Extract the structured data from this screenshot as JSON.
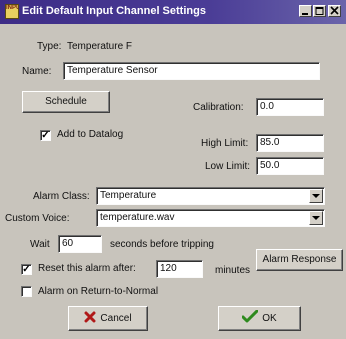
{
  "window": {
    "title": "Edit Default Input Channel Settings",
    "icon_text": "INPUT",
    "controls": [
      "minimize-icon",
      "maximize-icon",
      "close-icon"
    ]
  },
  "type": {
    "label": "Type:",
    "value": "Temperature F"
  },
  "name": {
    "label": "Name:",
    "value": "Temperature Sensor"
  },
  "schedule_button": "Schedule",
  "calibration": {
    "label": "Calibration:",
    "value": "0.0"
  },
  "add_to_datalog": {
    "label": "Add to Datalog",
    "checked": true
  },
  "high_limit": {
    "label": "High Limit:",
    "value": "85.0"
  },
  "low_limit": {
    "label": "Low Limit:",
    "value": "50.0"
  },
  "alarm_class": {
    "label": "Alarm Class:",
    "value": "Temperature"
  },
  "custom_voice": {
    "label": "Custom Voice:",
    "value": "temperature.wav"
  },
  "wait": {
    "label": "Wait",
    "value": "60",
    "suffix": "seconds before tripping"
  },
  "reset_alarm": {
    "label": "Reset this alarm after:",
    "value": "120",
    "suffix": "minutes",
    "checked": true
  },
  "alarm_response_button": "Alarm Response",
  "alarm_on_return": {
    "label": "Alarm on Return-to-Normal",
    "checked": false
  },
  "cancel_button": "Cancel",
  "ok_button": "OK",
  "check_mark": "✓"
}
